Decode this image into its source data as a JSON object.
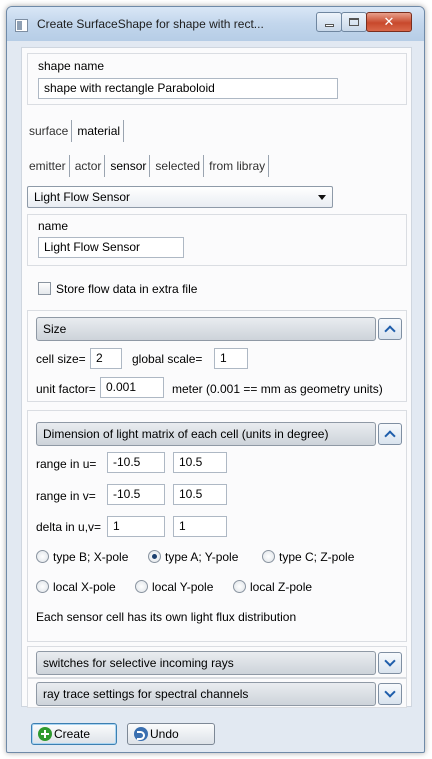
{
  "window": {
    "title": "Create SurfaceShape for shape with rect..."
  },
  "shape_name": {
    "label": "shape name",
    "value": "shape with rectangle Paraboloid"
  },
  "main_tabs": [
    {
      "label": "surface",
      "active": false
    },
    {
      "label": "material",
      "active": true
    }
  ],
  "sub_tabs": [
    {
      "label": "emitter",
      "active": false
    },
    {
      "label": "actor",
      "active": false
    },
    {
      "label": "sensor",
      "active": true
    },
    {
      "label": "selected",
      "active": false
    },
    {
      "label": "from libray",
      "active": false
    }
  ],
  "sensor_type": {
    "selected": "Light Flow Sensor"
  },
  "name_group": {
    "label": "name",
    "value": "Light Flow Sensor"
  },
  "store_flow": {
    "label": "Store flow data in extra file",
    "checked": false
  },
  "size_section": {
    "title": "Size",
    "cell_size_label": "cell size=",
    "cell_size_value": "2",
    "global_scale_label": "global scale=",
    "global_scale_value": "1",
    "unit_factor_label": "unit factor=",
    "unit_factor_value": "0.001",
    "unit_note": "meter (0.001 == mm as geometry units)"
  },
  "matrix_section": {
    "title": "Dimension of light matrix of each cell (units in degree)",
    "range_u_label": "range in u=",
    "range_u_min": "-10.5",
    "range_u_max": "10.5",
    "range_v_label": "range in v=",
    "range_v_min": "-10.5",
    "range_v_max": "10.5",
    "delta_label": "delta in u,v=",
    "delta_u": "1",
    "delta_v": "1",
    "radios_row1": [
      {
        "label": "type B; X-pole",
        "checked": false
      },
      {
        "label": "type A; Y-pole",
        "checked": true
      },
      {
        "label": "type C; Z-pole",
        "checked": false
      }
    ],
    "radios_row2": [
      {
        "label": "local X-pole",
        "checked": false
      },
      {
        "label": "local Y-pole",
        "checked": false
      },
      {
        "label": "local Z-pole",
        "checked": false
      }
    ],
    "note": "Each sensor cell has its own light flux distribution"
  },
  "switches_section": {
    "title": "switches for selective incoming rays"
  },
  "ray_trace_section": {
    "title": "ray trace settings for spectral channels"
  },
  "footer": {
    "create_label": "Create",
    "undo_label": "Undo"
  },
  "colors": {
    "accent": "#1f5eab",
    "create_icon": "#2f9a2f",
    "close_button": "#c8492c"
  }
}
